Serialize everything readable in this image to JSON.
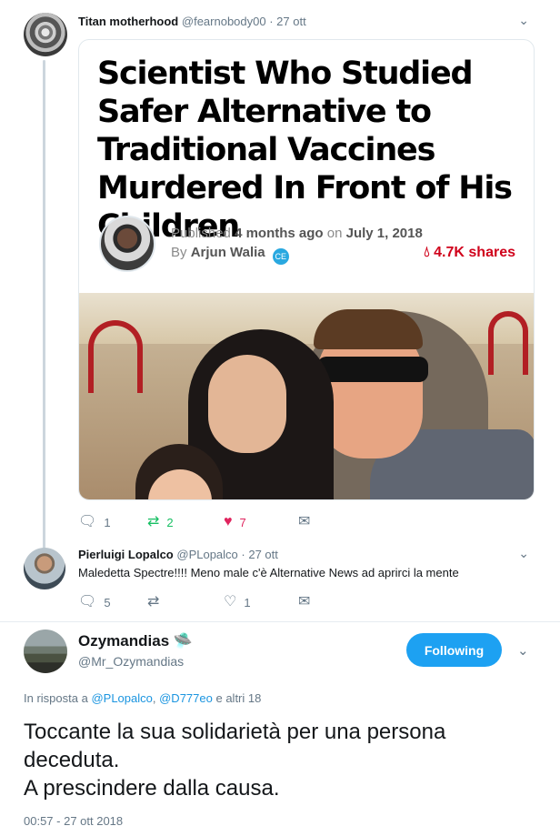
{
  "tweet1": {
    "name": "Titan motherhood",
    "handle": "@fearnobody00",
    "date": "· 27 ott",
    "card": {
      "headline": "Scientist Who Studied Safer Alternative to Traditional Vaccines Murdered In Front of His Children",
      "published_prefix": "Published",
      "published_age": "4 months ago",
      "published_on": "on",
      "published_date": "July 1, 2018",
      "by_prefix": "By",
      "author": "Arjun Walia",
      "badge": "CE",
      "shares": "4.7K shares"
    },
    "actions": {
      "replies": "1",
      "retweets": "2",
      "likes": "7"
    }
  },
  "tweet2": {
    "name": "Pierluigi Lopalco",
    "handle": "@PLopalco",
    "date": "· 27 ott",
    "text": "Maledetta Spectre!!!! Meno male c'è Alternative News ad aprirci la mente",
    "actions": {
      "replies": "5",
      "likes": "1"
    }
  },
  "main_tweet": {
    "name": "Ozymandias",
    "name_emoji": "🛸",
    "handle": "@Mr_Ozymandias",
    "follow_label": "Following",
    "in_reply_prefix": "In risposta a",
    "mention1": "@PLopalco",
    "mention_sep": ",",
    "mention2": "@D777eo",
    "others": "e altri 18",
    "text_line1": "Toccante la sua solidarietà per una persona deceduta.",
    "text_line2": "A prescindere dalla causa.",
    "timestamp": "00:57 - 27 ott 2018"
  },
  "colors": {
    "accent": "#1da1f2",
    "like": "#e0245e",
    "retweet": "#17bf63",
    "shares": "#d0021b",
    "muted": "#657786"
  }
}
